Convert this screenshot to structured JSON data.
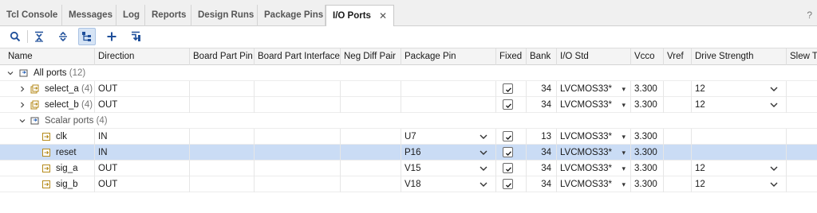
{
  "tabs": [
    {
      "label": "Tcl Console"
    },
    {
      "label": "Messages"
    },
    {
      "label": "Log"
    },
    {
      "label": "Reports"
    },
    {
      "label": "Design Runs"
    },
    {
      "label": "Package Pins"
    },
    {
      "label": "I/O Ports",
      "active": true,
      "close": "✕"
    }
  ],
  "help": "?",
  "toolbar": {
    "buttons": [
      "search-icon",
      "collapse-all-icon",
      "expand-all-icon",
      "group-by-interface-icon",
      "add-icon",
      "auto-assign-icon"
    ]
  },
  "columns": [
    "Name",
    "Direction",
    "Board Part Pin",
    "Board Part Interface",
    "Neg Diff Pair",
    "Package Pin",
    "Fixed",
    "Bank",
    "I/O Std",
    "Vcco",
    "Vref",
    "Drive Strength",
    "Slew Ty"
  ],
  "groups": {
    "all_ports": {
      "label": "All ports",
      "count": "(12)"
    },
    "scalar_ports": {
      "label": "Scalar ports",
      "count": "(4)"
    }
  },
  "bus_rows": [
    {
      "name": "select_a",
      "count": "(4)",
      "direction": "OUT",
      "bank": "34",
      "iostd": "LVCMOS33*",
      "vcco": "3.300",
      "drive": "12"
    },
    {
      "name": "select_b",
      "count": "(4)",
      "direction": "OUT",
      "bank": "34",
      "iostd": "LVCMOS33*",
      "vcco": "3.300",
      "drive": "12"
    }
  ],
  "scalar_rows": [
    {
      "name": "clk",
      "direction": "IN",
      "pin": "U7",
      "bank": "13",
      "iostd": "LVCMOS33*",
      "vcco": "3.300",
      "drive": "",
      "selected": false
    },
    {
      "name": "reset",
      "direction": "IN",
      "pin": "P16",
      "bank": "34",
      "iostd": "LVCMOS33*",
      "vcco": "3.300",
      "drive": "",
      "selected": true
    },
    {
      "name": "sig_a",
      "direction": "OUT",
      "pin": "V15",
      "bank": "34",
      "iostd": "LVCMOS33*",
      "vcco": "3.300",
      "drive": "12",
      "selected": false
    },
    {
      "name": "sig_b",
      "direction": "OUT",
      "pin": "V18",
      "bank": "34",
      "iostd": "LVCMOS33*",
      "vcco": "3.300",
      "drive": "12",
      "selected": false
    }
  ],
  "colors": {
    "selected_row": "#cadcf5",
    "accent": "#2a63b8",
    "port_icon": "#b58a1a"
  }
}
